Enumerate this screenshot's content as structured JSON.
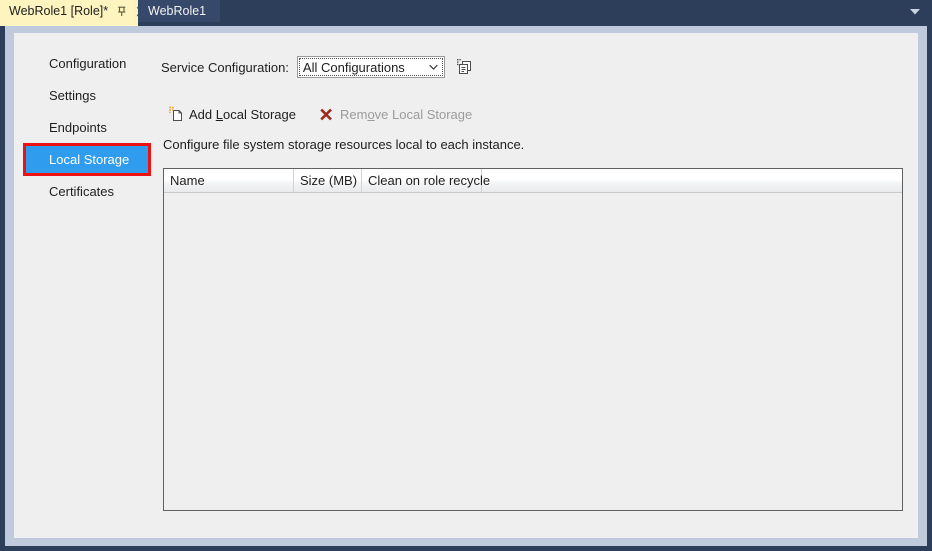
{
  "window": {
    "tabs": [
      {
        "label": "WebRole1 [Role]*",
        "active": true,
        "pin_icon": "pin-icon",
        "close_icon": "close-icon"
      },
      {
        "label": "WebRole1",
        "active": false
      }
    ],
    "overflow_icon": "chevron-down-icon"
  },
  "sidebar": {
    "items": [
      {
        "label": "Configuration",
        "selected": false
      },
      {
        "label": "Settings",
        "selected": false
      },
      {
        "label": "Endpoints",
        "selected": false
      },
      {
        "label": "Local Storage",
        "selected": true
      },
      {
        "label": "Certificates",
        "selected": false
      }
    ],
    "highlight_color": "#ee1111",
    "selected_color": "#2f9ced"
  },
  "service_configuration": {
    "label": "Service Configuration:",
    "label_accel": "g",
    "selected_value": "All Configurations",
    "options": [
      "All Configurations"
    ],
    "dropdown_icon": "chevron-down-icon",
    "manage_button_icon": "copy-configurations-icon"
  },
  "toolbar": {
    "add_label_before": "Add ",
    "add_label_accel": "L",
    "add_label_after": "ocal Storage",
    "add_label": "Add Local Storage",
    "add_icon": "add-new-item-icon",
    "add_enabled": true,
    "remove_label_before": "Rem",
    "remove_label_accel": "o",
    "remove_label_after": "ve Local Storage",
    "remove_label": "Remove Local Storage",
    "remove_icon": "delete-x-icon",
    "remove_enabled": false
  },
  "main": {
    "description": "Configure file system storage resources local to each instance."
  },
  "grid": {
    "columns": [
      {
        "header": "Name"
      },
      {
        "header": "Size (MB)"
      },
      {
        "header": "Clean on role recycle"
      }
    ],
    "rows": []
  }
}
